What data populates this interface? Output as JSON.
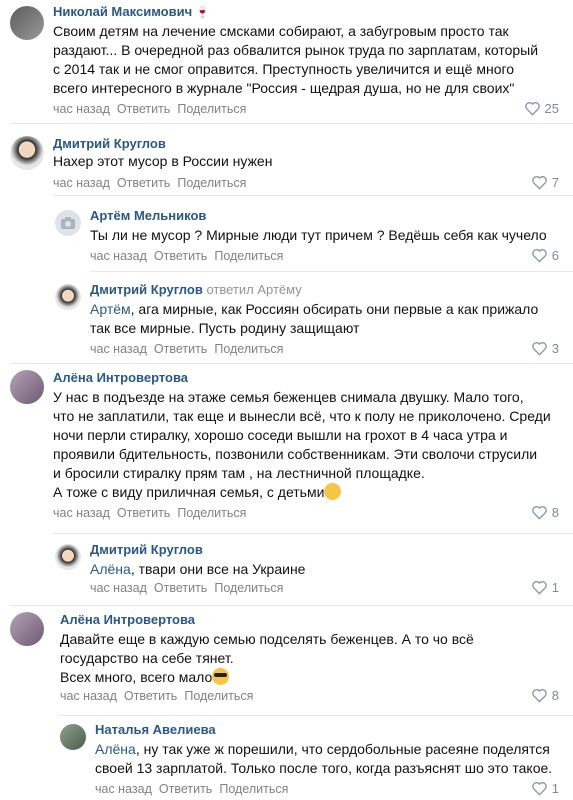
{
  "actions": {
    "reply": "Ответить",
    "share": "Поделиться"
  },
  "comments": [
    {
      "author": "Николай Максимович",
      "badge": "🍷",
      "lines": [
        "Своим детям на лечение смсками собирают, а забугровым просто так",
        "раздают... В очередной раз обвалится рынок труда по зарплатам, который",
        "с 2014 так и не смог оправится. Преступность увеличится и ещё много",
        "всего интересного в журнале \"Россия - щедрая душа, но не для своих\""
      ],
      "time": "час назад",
      "likes": "25"
    },
    {
      "author": "Дмитрий Круглов",
      "lines": [
        "Нахер этот мусор в России нужен"
      ],
      "time": "час назад",
      "likes": "7"
    },
    {
      "author": "Артём Мельников",
      "lines": [
        "Ты ли не мусор ? Мирные люди тут причем ? Ведёшь себя как чучело"
      ],
      "time": "час назад",
      "likes": "6"
    },
    {
      "author": "Дмитрий Круглов",
      "replied": "ответил Артёму",
      "to": "Артём",
      "lines": [
        ", ага мирные, как Россиян обсирать они первые а как прижало",
        "так все мирные. Пусть родину защищают"
      ],
      "time": "час назад",
      "likes": "3"
    },
    {
      "author": "Алёна Интровертова",
      "lines": [
        "У нас в подъезде на этаже семья беженцев снимала двушку. Мало того,",
        "что не заплатили, так еще и вынесли всё, что к полу не приколочено. Среди",
        "ночи перли стиралку, хорошо соседи вышли на грохот в 4 часа утра и",
        "проявили бдительность, позвонили собственникам. Эти сволочи струсили",
        "и бросили стиралку прям там , на лестничной площадке.",
        "А тоже с виду приличная семья, с детьми"
      ],
      "time": "час назад",
      "likes": "8"
    },
    {
      "author": "Дмитрий Круглов",
      "to": "Алёна",
      "lines": [
        ", твари они все на Украине"
      ],
      "time": "час назад",
      "likes": "1"
    },
    {
      "author": "Алёна Интровертова",
      "lines": [
        "Давайте еще в каждую семью подселять беженцев. А то чо всё",
        "государство на себе тянет.",
        "Всех много, всего мало"
      ],
      "time": "час назад",
      "likes": "8"
    },
    {
      "author": "Наталья Авелиева",
      "to": "Алёна",
      "lines": [
        ", ну так уже ж порешили, что сердобольные расеяне поделятся",
        "своей 13 зарплатой. Только после того, когда разъяснят шо это такое."
      ],
      "time": "час назад",
      "likes": "1"
    }
  ]
}
